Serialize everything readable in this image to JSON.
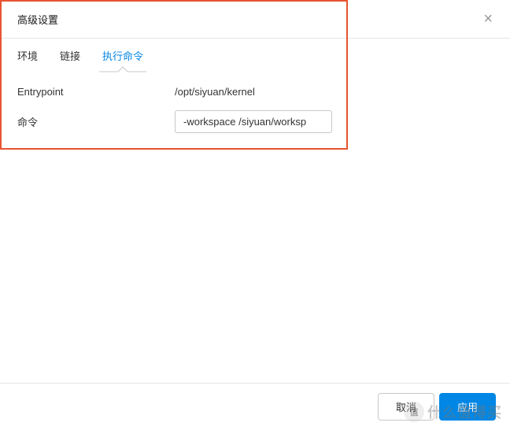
{
  "dialog": {
    "title": "高级设置"
  },
  "tabs": {
    "env": "环境",
    "link": "链接",
    "exec": "执行命令"
  },
  "form": {
    "entrypoint_label": "Entrypoint",
    "entrypoint_value": "/opt/siyuan/kernel",
    "command_label": "命令",
    "command_value": "-workspace /siyuan/worksp"
  },
  "footer": {
    "cancel": "取消",
    "apply": "应用"
  },
  "watermark": {
    "badge": "值",
    "text": "什么值得买"
  }
}
